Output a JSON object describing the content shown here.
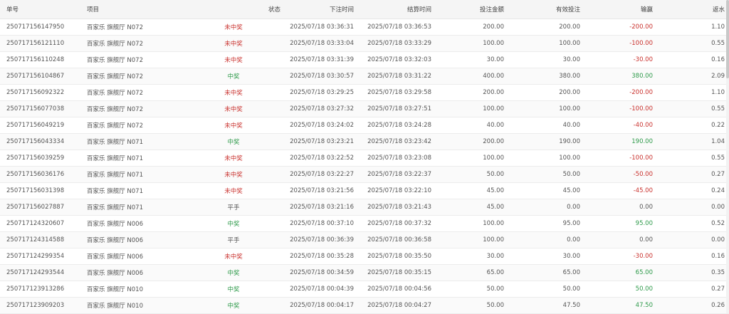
{
  "table": {
    "headers": {
      "id": "单号",
      "item": "项目",
      "status": "状态",
      "bet_time": "下注时间",
      "settle_time": "结算时间",
      "bet_amount": "投注金额",
      "valid_bet": "有效投注",
      "win_loss": "输赢",
      "rebate": "返水"
    },
    "rows": [
      {
        "id": "250717156147950",
        "item": "百家乐 旗舰厅 N072",
        "status": "未中奖",
        "status_type": "lose",
        "bet_time": "2025/07/18 03:36:31",
        "settle_time": "2025/07/18 03:36:53",
        "bet_amount": "200.00",
        "valid_bet": "200.00",
        "win_loss": "-200.00",
        "win_type": "neg",
        "rebate": "1.10"
      },
      {
        "id": "250717156121110",
        "item": "百家乐 旗舰厅 N072",
        "status": "未中奖",
        "status_type": "lose",
        "bet_time": "2025/07/18 03:33:04",
        "settle_time": "2025/07/18 03:33:29",
        "bet_amount": "100.00",
        "valid_bet": "100.00",
        "win_loss": "-100.00",
        "win_type": "neg",
        "rebate": "0.55"
      },
      {
        "id": "250717156110248",
        "item": "百家乐 旗舰厅 N072",
        "status": "未中奖",
        "status_type": "lose",
        "bet_time": "2025/07/18 03:31:39",
        "settle_time": "2025/07/18 03:32:03",
        "bet_amount": "30.00",
        "valid_bet": "30.00",
        "win_loss": "-30.00",
        "win_type": "neg",
        "rebate": "0.16"
      },
      {
        "id": "250717156104867",
        "item": "百家乐 旗舰厅 N072",
        "status": "中奖",
        "status_type": "win",
        "bet_time": "2025/07/18 03:30:57",
        "settle_time": "2025/07/18 03:31:22",
        "bet_amount": "400.00",
        "valid_bet": "380.00",
        "win_loss": "380.00",
        "win_type": "pos",
        "rebate": "2.09"
      },
      {
        "id": "250717156092322",
        "item": "百家乐 旗舰厅 N072",
        "status": "未中奖",
        "status_type": "lose",
        "bet_time": "2025/07/18 03:29:25",
        "settle_time": "2025/07/18 03:29:58",
        "bet_amount": "200.00",
        "valid_bet": "200.00",
        "win_loss": "-200.00",
        "win_type": "neg",
        "rebate": "1.10"
      },
      {
        "id": "250717156077038",
        "item": "百家乐 旗舰厅 N072",
        "status": "未中奖",
        "status_type": "lose",
        "bet_time": "2025/07/18 03:27:32",
        "settle_time": "2025/07/18 03:27:51",
        "bet_amount": "100.00",
        "valid_bet": "100.00",
        "win_loss": "-100.00",
        "win_type": "neg",
        "rebate": "0.55"
      },
      {
        "id": "250717156049219",
        "item": "百家乐 旗舰厅 N072",
        "status": "未中奖",
        "status_type": "lose",
        "bet_time": "2025/07/18 03:24:02",
        "settle_time": "2025/07/18 03:24:28",
        "bet_amount": "40.00",
        "valid_bet": "40.00",
        "win_loss": "-40.00",
        "win_type": "neg",
        "rebate": "0.22"
      },
      {
        "id": "250717156043334",
        "item": "百家乐 旗舰厅 N071",
        "status": "中奖",
        "status_type": "win",
        "bet_time": "2025/07/18 03:23:21",
        "settle_time": "2025/07/18 03:23:42",
        "bet_amount": "200.00",
        "valid_bet": "190.00",
        "win_loss": "190.00",
        "win_type": "pos",
        "rebate": "1.04"
      },
      {
        "id": "250717156039259",
        "item": "百家乐 旗舰厅 N071",
        "status": "未中奖",
        "status_type": "lose",
        "bet_time": "2025/07/18 03:22:52",
        "settle_time": "2025/07/18 03:23:08",
        "bet_amount": "100.00",
        "valid_bet": "100.00",
        "win_loss": "-100.00",
        "win_type": "neg",
        "rebate": "0.55"
      },
      {
        "id": "250717156036176",
        "item": "百家乐 旗舰厅 N071",
        "status": "未中奖",
        "status_type": "lose",
        "bet_time": "2025/07/18 03:22:27",
        "settle_time": "2025/07/18 03:22:37",
        "bet_amount": "50.00",
        "valid_bet": "50.00",
        "win_loss": "-50.00",
        "win_type": "neg",
        "rebate": "0.27"
      },
      {
        "id": "250717156031398",
        "item": "百家乐 旗舰厅 N071",
        "status": "未中奖",
        "status_type": "lose",
        "bet_time": "2025/07/18 03:21:56",
        "settle_time": "2025/07/18 03:22:10",
        "bet_amount": "45.00",
        "valid_bet": "45.00",
        "win_loss": "-45.00",
        "win_type": "neg",
        "rebate": "0.24"
      },
      {
        "id": "250717156027887",
        "item": "百家乐 旗舰厅 N071",
        "status": "平手",
        "status_type": "draw",
        "bet_time": "2025/07/18 03:21:16",
        "settle_time": "2025/07/18 03:21:43",
        "bet_amount": "45.00",
        "valid_bet": "0.00",
        "win_loss": "0.00",
        "win_type": "zero",
        "rebate": "0.00"
      },
      {
        "id": "250717124320607",
        "item": "百家乐 旗舰厅 N006",
        "status": "中奖",
        "status_type": "win",
        "bet_time": "2025/07/18 00:37:10",
        "settle_time": "2025/07/18 00:37:32",
        "bet_amount": "100.00",
        "valid_bet": "95.00",
        "win_loss": "95.00",
        "win_type": "pos",
        "rebate": "0.52"
      },
      {
        "id": "250717124314588",
        "item": "百家乐 旗舰厅 N006",
        "status": "平手",
        "status_type": "draw",
        "bet_time": "2025/07/18 00:36:39",
        "settle_time": "2025/07/18 00:36:58",
        "bet_amount": "100.00",
        "valid_bet": "0.00",
        "win_loss": "0.00",
        "win_type": "zero",
        "rebate": "0.00"
      },
      {
        "id": "250717124299354",
        "item": "百家乐 旗舰厅 N006",
        "status": "未中奖",
        "status_type": "lose",
        "bet_time": "2025/07/18 00:35:28",
        "settle_time": "2025/07/18 00:35:50",
        "bet_amount": "30.00",
        "valid_bet": "30.00",
        "win_loss": "-30.00",
        "win_type": "neg",
        "rebate": "0.16"
      },
      {
        "id": "250717124293544",
        "item": "百家乐 旗舰厅 N006",
        "status": "中奖",
        "status_type": "win",
        "bet_time": "2025/07/18 00:34:59",
        "settle_time": "2025/07/18 00:35:15",
        "bet_amount": "65.00",
        "valid_bet": "65.00",
        "win_loss": "65.00",
        "win_type": "pos",
        "rebate": "0.35"
      },
      {
        "id": "250717123913286",
        "item": "百家乐 旗舰厅 N010",
        "status": "中奖",
        "status_type": "win",
        "bet_time": "2025/07/18 00:04:39",
        "settle_time": "2025/07/18 00:04:56",
        "bet_amount": "50.00",
        "valid_bet": "50.00",
        "win_loss": "50.00",
        "win_type": "pos",
        "rebate": "0.27"
      },
      {
        "id": "250717123909203",
        "item": "百家乐 旗舰厅 N010",
        "status": "中奖",
        "status_type": "win",
        "bet_time": "2025/07/18 00:04:17",
        "settle_time": "2025/07/18 00:04:27",
        "bet_amount": "50.00",
        "valid_bet": "47.50",
        "win_loss": "47.50",
        "win_type": "pos",
        "rebate": "0.26"
      }
    ]
  },
  "colors": {
    "lose": "#c9302c",
    "win": "#2e9a4a",
    "header_bg": "#f5f5f5"
  }
}
